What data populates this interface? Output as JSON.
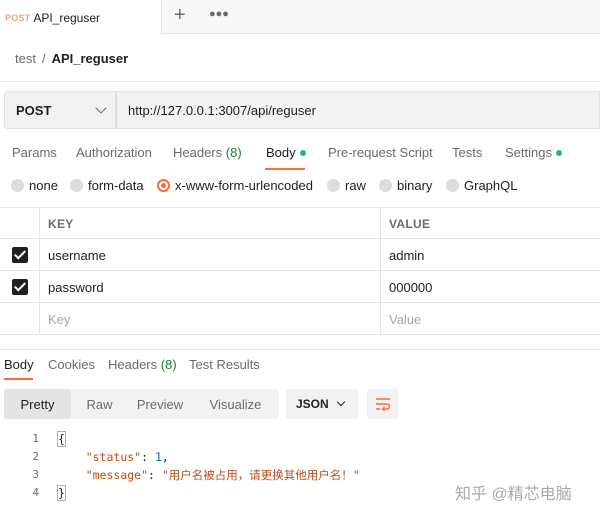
{
  "tab": {
    "method": "POST",
    "name": "API_reguser"
  },
  "breadcrumb": {
    "parent": "test",
    "separator": "/",
    "current": "API_reguser"
  },
  "request": {
    "method": "POST",
    "url": "http://127.0.0.1:3007/api/reguser"
  },
  "request_tabs": {
    "params": "Params",
    "authorization": "Authorization",
    "headers": "Headers",
    "headers_count": "(8)",
    "body": "Body",
    "pre_request": "Pre-request Script",
    "tests": "Tests",
    "settings": "Settings"
  },
  "body_modes": {
    "none": "none",
    "form_data": "form-data",
    "urlencoded": "x-www-form-urlencoded",
    "raw": "raw",
    "binary": "binary",
    "graphql": "GraphQL",
    "selected": "x-www-form-urlencoded"
  },
  "params_table": {
    "headers": {
      "key": "KEY",
      "value": "VALUE"
    },
    "rows": [
      {
        "checked": true,
        "key": "username",
        "value": "admin"
      },
      {
        "checked": true,
        "key": "password",
        "value": "000000"
      }
    ],
    "placeholder": {
      "key": "Key",
      "value": "Value"
    }
  },
  "response_tabs": {
    "body": "Body",
    "cookies": "Cookies",
    "headers": "Headers",
    "headers_count": "(8)",
    "test_results": "Test Results"
  },
  "view_modes": {
    "pretty": "Pretty",
    "raw": "Raw",
    "preview": "Preview",
    "visualize": "Visualize",
    "active": "Pretty"
  },
  "format": {
    "selected": "JSON"
  },
  "code": {
    "line_numbers": [
      "1",
      "2",
      "3",
      "4"
    ],
    "open_brace": "{",
    "close_brace": "}",
    "status_key": "\"status\"",
    "status_value": "1",
    "message_key": "\"message\"",
    "message_value": "\"用户名被占用，请更换其他用户名！\""
  },
  "watermark": {
    "text": "知乎 @精芯电脑"
  },
  "colors": {
    "accent": "#ff6c37",
    "green_dot": "#26b47f",
    "count_green": "#1a7f37",
    "method_orange": "#f0a27e"
  },
  "icons": {
    "new_tab": "plus-icon",
    "more": "more-icon",
    "wrap": "wrap-lines-icon"
  }
}
